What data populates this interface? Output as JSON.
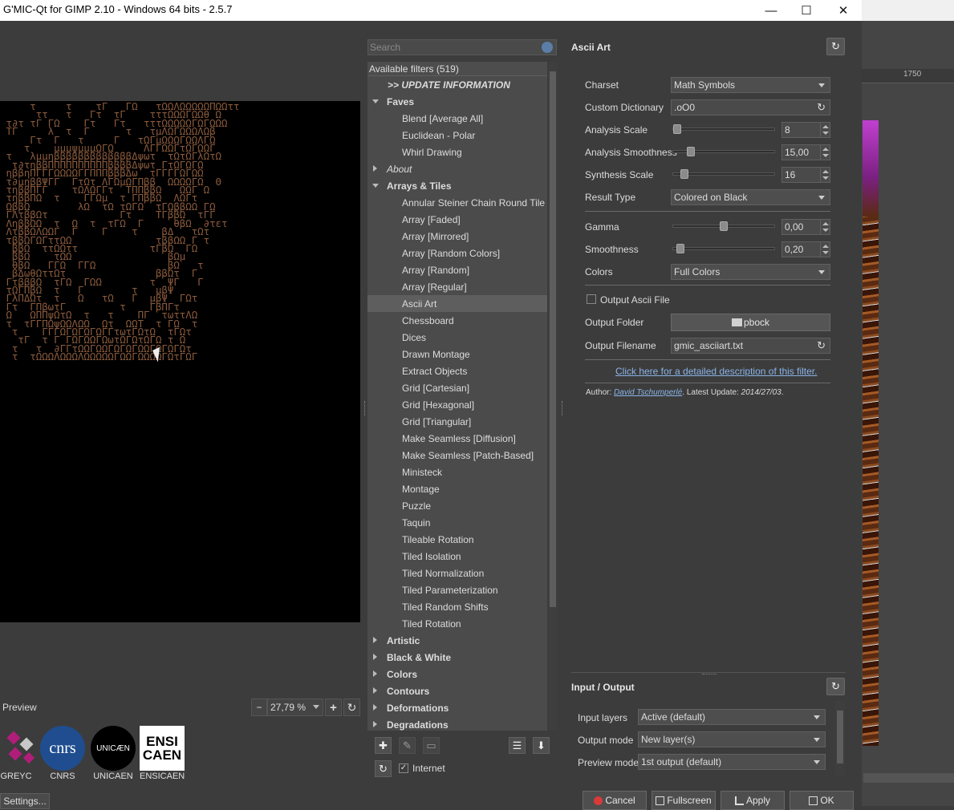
{
  "window": {
    "title": "G'MIC-Qt for GIMP 2.10 - Windows 64 bits - 2.5.7",
    "minimize": "—",
    "maximize": "☐",
    "close": "✕"
  },
  "gimp": {
    "ruler_label": "1750"
  },
  "preview": {
    "label": "Preview",
    "zoom": "27,79 %",
    "zoom_out": "−",
    "zoom_in": "+",
    "reset": "↻",
    "ascii_art": "     τ     τ    τΓ   ΓΩ   τΩΩΛΩΩΩΩΩΠΩΩττ\n      ττ   τ   Γτ  τΓ    τττΩΩΩΓΩΩθ Ω\n τ∂τ τΓ ΓΩ    Γτ   Γτ   τττΩΩΩΩΩΓΩΓΩΩΩ\n ΤΓ     λ  τ  Γ      τ   τμΛΩΓΩΩΩΛΩβ\n     Γτ  Γ   τ     Γ   τΩΓμΩΩΩΓΩΩΛΓΩ\n    τ    μμμψμμμΩΓΩ     ΛΓΓΩΩΓτΩΓΩΩΓ\n τ   λμμηβββββββββββββΔψωτ  τΩτΩΓλΩτΩ\n  τ∂τηββΠΠΠΠΠΠΠΠΠΠββββΔψωτ ΓτΩΓΩΓΩ\n ηββηΠΓΓΓΩΩΩΩΓΓΠΠΠβββΔω  τΓΓΓΓΩΓΩΩ\n τ∂μηββΨΓΓ  ΓτΩτ ΛΓΩμΩΓΠββ  ΩΩΩΩΓΩ  Θ\n τηββΠΓΓ    τΩΛΩΓΓτ  ΤΠΠββΩ   ΩΩΓ Ω\n τηββΠΩ  τ    ΓΓΩμ  τ ΓΠββΩ  ΛΩΓτ\n ΩββΩ        λΩ  τΩ τΩΓΩ  τΓΩββΩΩ ΓΩ\n ΓΛτββΩτ            Γτ    ΤΓββΩ  τΓΓ\n ΛηββΩΩ  τ  Ω  τ  τΓΩ  Γ     θβΩ  ∂τετ\n ΛτββΩΛΩΩΓ  Γ    Γ    τ    βΔ   τΩτ\n τββΩΓΩΓττΩΩ              τββΩΩ Γ τ\n  ββΩ  ττΩΩττ            τΓβΩ  ΓΩ\n  ββΩ    τΩΩ                βΩμ\n  θβΩ   ΓΓΩ  ΓΓΩ            βΩ   τ\n  βΔωθΩττΩτ               ββΩτ  Γ\n ΓτβββΩ  τΓΩ  ΓΩΩ        τ  ΨΓ   Γ\n τΩΓΠβΩ  τ   Γ        τ   μβΨ\n ΓλΠΔΩτ  τ   Ω   τΩ   Γ  μβΨ  ΓΩτ\n Γτ  ΓΠβωτΓ         τ    ΓβΠΓτ\n Ω   ΩΠΠψΩτΩ  τ   τ    ΠΓ  τωττΛΩ\n τ  τΓΓΠΩψΩΩΛΩΩ  Ωτ  ΩΩΤ  τ ΓΩ  τ\n  τ    ΓΓΓΩΓΩΓΩΓΩΓΓτωτΓΩτΩ  τΓΩτ\n   τΓ  τ Γ ΓΩΓΩΩΓΩωτΩΓΩτΩΓΩ τ Ω\n  τ   τ  ∂ΓΓτΩΩΓΩΩΓΩΓΩΓΩΩΓΩΓΩΓΩτ\n  τ  τΩΩΩΛΩΩΩΛΩΩΩΩΩΓΩΩΓΩΩΩΩΓΩτΓΩΓ"
  },
  "logos": [
    {
      "text": "GREYC"
    },
    {
      "text": "CNRS",
      "mark": "cnrs"
    },
    {
      "text": "UNICAEN",
      "mark": "UNICÆN"
    },
    {
      "text": "ENSICAEN",
      "mark1": "ENSI",
      "mark2": "CAEN"
    }
  ],
  "settings_button": "Settings...",
  "filters": {
    "search_placeholder": "Search",
    "header": "Available filters (519)",
    "tree": [
      {
        "label": ">> UPDATE INFORMATION",
        "kind": "update"
      },
      {
        "label": "Faves",
        "kind": "cat-open"
      },
      {
        "label": "Blend [Average All]",
        "kind": "leaf"
      },
      {
        "label": "Euclidean - Polar",
        "kind": "leaf"
      },
      {
        "label": "Whirl Drawing",
        "kind": "leaf"
      },
      {
        "label": "About",
        "kind": "cat-closed-italic"
      },
      {
        "label": "Arrays & Tiles",
        "kind": "cat-open"
      },
      {
        "label": "Annular Steiner Chain Round Tile",
        "kind": "leaf"
      },
      {
        "label": "Array [Faded]",
        "kind": "leaf"
      },
      {
        "label": "Array [Mirrored]",
        "kind": "leaf"
      },
      {
        "label": "Array [Random Colors]",
        "kind": "leaf"
      },
      {
        "label": "Array [Random]",
        "kind": "leaf"
      },
      {
        "label": "Array [Regular]",
        "kind": "leaf"
      },
      {
        "label": "Ascii Art",
        "kind": "leaf-selected"
      },
      {
        "label": "Chessboard",
        "kind": "leaf"
      },
      {
        "label": "Dices",
        "kind": "leaf"
      },
      {
        "label": "Drawn Montage",
        "kind": "leaf"
      },
      {
        "label": "Extract Objects",
        "kind": "leaf"
      },
      {
        "label": "Grid [Cartesian]",
        "kind": "leaf"
      },
      {
        "label": "Grid [Hexagonal]",
        "kind": "leaf"
      },
      {
        "label": "Grid [Triangular]",
        "kind": "leaf"
      },
      {
        "label": "Make Seamless [Diffusion]",
        "kind": "leaf"
      },
      {
        "label": "Make Seamless [Patch-Based]",
        "kind": "leaf"
      },
      {
        "label": "Ministeck",
        "kind": "leaf"
      },
      {
        "label": "Montage",
        "kind": "leaf"
      },
      {
        "label": "Puzzle",
        "kind": "leaf"
      },
      {
        "label": "Taquin",
        "kind": "leaf"
      },
      {
        "label": "Tileable Rotation",
        "kind": "leaf"
      },
      {
        "label": "Tiled Isolation",
        "kind": "leaf"
      },
      {
        "label": "Tiled Normalization",
        "kind": "leaf"
      },
      {
        "label": "Tiled Parameterization",
        "kind": "leaf"
      },
      {
        "label": "Tiled Random Shifts",
        "kind": "leaf"
      },
      {
        "label": "Tiled Rotation",
        "kind": "leaf"
      },
      {
        "label": "Artistic",
        "kind": "cat-closed"
      },
      {
        "label": "Black & White",
        "kind": "cat-closed"
      },
      {
        "label": "Colors",
        "kind": "cat-closed"
      },
      {
        "label": "Contours",
        "kind": "cat-closed"
      },
      {
        "label": "Deformations",
        "kind": "cat-closed"
      },
      {
        "label": "Degradations",
        "kind": "cat-closed"
      }
    ],
    "internet_label": "Internet",
    "internet_checked": "✓"
  },
  "params": {
    "title": "Ascii Art",
    "charset_label": "Charset",
    "charset_value": "Math Symbols",
    "dict_label": "Custom Dictionary",
    "dict_value": ".oO0",
    "analysis_scale_label": "Analysis Scale",
    "analysis_scale_value": "8",
    "analysis_smooth_label": "Analysis Smoothness",
    "analysis_smooth_value": "15,00",
    "synth_scale_label": "Synthesis Scale",
    "synth_scale_value": "16",
    "result_type_label": "Result Type",
    "result_type_value": "Colored on Black",
    "gamma_label": "Gamma",
    "gamma_value": "0,00",
    "smoothness_label": "Smoothness",
    "smoothness_value": "0,20",
    "colors_label": "Colors",
    "colors_value": "Full Colors",
    "output_ascii_label": "Output Ascii File",
    "output_folder_label": "Output Folder",
    "output_folder_value": "pbock",
    "output_filename_label": "Output Filename",
    "output_filename_value": "gmic_asciiart.txt",
    "link": "Click here for a detailed description of this filter.",
    "author_prefix": "Author: ",
    "author_name": "David Tschumperlé",
    "author_mid": ". Latest Update: ",
    "author_date": "2014/27/03",
    "author_end": "."
  },
  "io": {
    "title": "Input / Output",
    "input_label": "Input layers",
    "input_value": "Active (default)",
    "output_label": "Output mode",
    "output_value": "New layer(s)",
    "preview_label": "Preview mode",
    "preview_value": "1st output (default)"
  },
  "buttons": {
    "cancel": "Cancel",
    "fullscreen": "Fullscreen",
    "apply": "Apply",
    "ok": "OK"
  },
  "colors": {
    "cancel_icon": "#d83a3a",
    "ascii_brown": "#8a5a3c"
  }
}
